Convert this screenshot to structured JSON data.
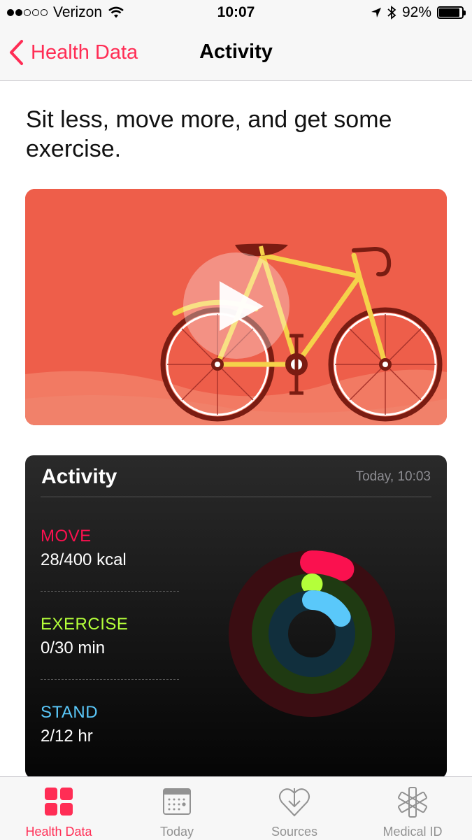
{
  "status_bar": {
    "carrier": "Verizon",
    "time": "10:07",
    "battery_percent": "92%",
    "battery_level": 0.92,
    "signal_bars_filled": 2,
    "signal_bars_total": 5
  },
  "nav": {
    "back_label": "Health Data",
    "title": "Activity"
  },
  "intro_text": "Sit less, move more, and get some exercise.",
  "activity": {
    "title": "Activity",
    "timestamp": "Today, 10:03",
    "metrics": [
      {
        "label": "MOVE",
        "value": "28/400 kcal",
        "color": "#fa114f",
        "progress": 0.07
      },
      {
        "label": "EXERCISE",
        "value": "0/30 min",
        "color": "#b4ff3a",
        "progress": 0.0
      },
      {
        "label": "STAND",
        "value": "2/12 hr",
        "color": "#5ac8fa",
        "progress": 0.1667
      }
    ]
  },
  "tabs": [
    {
      "label": "Health Data",
      "icon": "grid-icon",
      "active": true
    },
    {
      "label": "Today",
      "icon": "calendar-icon",
      "active": false
    },
    {
      "label": "Sources",
      "icon": "heart-download-icon",
      "active": false
    },
    {
      "label": "Medical ID",
      "icon": "medical-asterisk-icon",
      "active": false
    }
  ],
  "colors": {
    "accent": "#ff2d55",
    "video_background": "#ee5e4a",
    "move": "#fa114f",
    "exercise": "#b4ff3a",
    "stand": "#5ac8fa"
  }
}
